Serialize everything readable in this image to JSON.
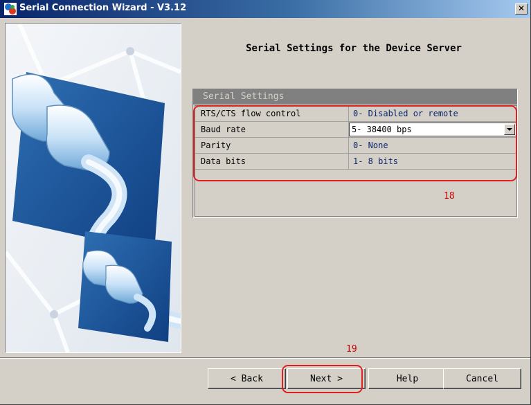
{
  "window": {
    "title": "Serial Connection Wizard - V3.12",
    "close_glyph": "✕"
  },
  "page": {
    "heading": "Serial Settings for the Device Server"
  },
  "settings": {
    "group_title": "Serial Settings",
    "rows": [
      {
        "label": "RTS/CTS flow control",
        "value": "0- Disabled or remote"
      },
      {
        "label": "Baud rate",
        "value": "5- 38400 bps",
        "editor": "dropdown"
      },
      {
        "label": "Parity",
        "value": "0- None"
      },
      {
        "label": "Data bits",
        "value": "1- 8 bits"
      }
    ]
  },
  "annotations": {
    "settings_marker": "18",
    "next_marker": "19"
  },
  "buttons": {
    "back": "< Back",
    "next": "Next >",
    "help": "Help",
    "cancel": "Cancel"
  },
  "icons": {
    "app": "wizard-app-icon",
    "close": "close-icon",
    "dropdown": "chevron-down-icon",
    "illustration": "serial-connector-illustration"
  },
  "colors": {
    "title_start": "#0a246a",
    "title_end": "#a6caf0",
    "value_text": "#0a246a",
    "annotation": "#e02020",
    "panel_face": "#d4d0c8"
  }
}
